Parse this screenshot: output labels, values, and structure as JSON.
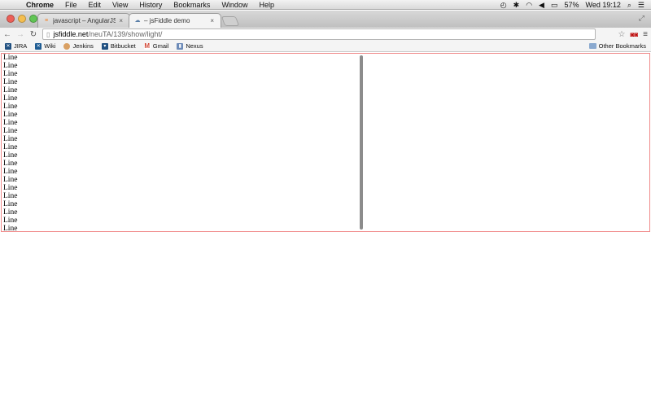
{
  "menubar": {
    "app": "Chrome",
    "items": [
      "File",
      "Edit",
      "View",
      "History",
      "Bookmarks",
      "Window",
      "Help"
    ],
    "battery": "57%",
    "clock": "Wed 19:12"
  },
  "tabs": [
    {
      "label": "javascript – AngularJS – How",
      "active": false
    },
    {
      "label": "– jsFiddle demo",
      "active": true
    }
  ],
  "address": {
    "host": "jsfiddle.net",
    "path": "/neuTA/139/show/light/"
  },
  "bookmarks": [
    {
      "label": "JIRA",
      "icon": "jira-icon"
    },
    {
      "label": "Wiki",
      "icon": "wiki-icon"
    },
    {
      "label": "Jenkins",
      "icon": "jenkins-icon"
    },
    {
      "label": "Bitbucket",
      "icon": "bitbucket-icon"
    },
    {
      "label": "Gmail",
      "icon": "gmail-icon"
    },
    {
      "label": "Nexus",
      "icon": "nexus-icon"
    }
  ],
  "other_bookmarks": "Other Bookmarks",
  "content": {
    "lines": [
      "Line",
      "Line",
      "Line",
      "Line",
      "Line",
      "Line",
      "Line",
      "Line",
      "Line",
      "Line",
      "Line",
      "Line",
      "Line",
      "Line",
      "Line",
      "Line",
      "Line",
      "Line",
      "Line",
      "Line",
      "Line",
      "Line"
    ]
  },
  "colors": {
    "frame_border": "#f08a8a",
    "scrollbar": "#8c8c8c"
  }
}
